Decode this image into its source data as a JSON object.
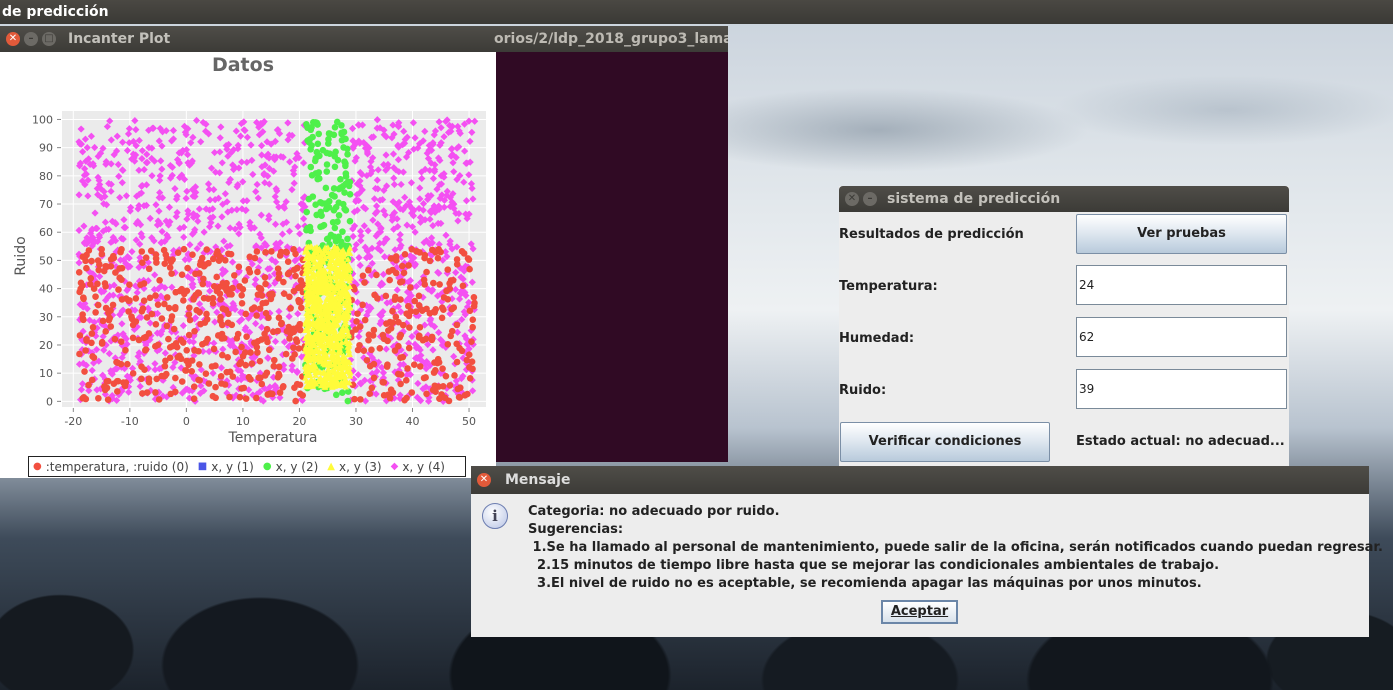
{
  "desktop": {
    "top_title": "de predicción"
  },
  "plot_window": {
    "title": "Incanter Plot",
    "path_fragment": "orios/2/ldp_2018_grupo3_lama"
  },
  "chart_data": {
    "type": "scatter",
    "title": "Datos",
    "xlabel": "Temperatura",
    "ylabel": "Ruido",
    "xlim": [
      -22,
      53
    ],
    "ylim": [
      -2,
      103
    ],
    "x_ticks": [
      "-20",
      "-10",
      "0",
      "10",
      "20",
      "30",
      "40",
      "50"
    ],
    "y_ticks": [
      "0",
      "10",
      "20",
      "30",
      "40",
      "50",
      "60",
      "70",
      "80",
      "90",
      "100"
    ],
    "grid": true,
    "legend_position": "bottom",
    "series": [
      {
        "name": ":temperatura, :ruido (0)",
        "color": "#f24f3f",
        "marker": "circle",
        "region": {
          "x": [
            -19,
            51
          ],
          "y": [
            0,
            54
          ]
        }
      },
      {
        "name": "x, y (1)",
        "color": "#4a55e6",
        "marker": "square",
        "region": null
      },
      {
        "name": "x, y (2)",
        "color": "#4ef04a",
        "marker": "circle",
        "region": {
          "x": [
            21,
            29
          ],
          "y": [
            0,
            100
          ]
        }
      },
      {
        "name": "x, y (3)",
        "color": "#fffb3a",
        "marker": "triangle",
        "region": {
          "x": [
            21,
            29
          ],
          "y": [
            5,
            55
          ]
        }
      },
      {
        "name": "x, y (4)",
        "color": "#f450f2",
        "marker": "diamond",
        "region": {
          "x": [
            -19,
            51
          ],
          "y": [
            0,
            100
          ]
        }
      }
    ]
  },
  "prediction_window": {
    "title": "sistema de predicción",
    "results_label": "Resultados de predicción",
    "ver_pruebas": "Ver pruebas",
    "temp_label": "Temperatura:",
    "temp_value": "24",
    "hum_label": "Humedad:",
    "hum_value": "62",
    "ruido_label": "Ruido:",
    "ruido_value": "39",
    "verify_button": "Verificar condiciones",
    "status": "Estado actual: no adecuad..."
  },
  "message_dialog": {
    "title": "Mensaje",
    "lines": [
      "Categoria: no adecuado por ruido.",
      "Sugerencias:",
      " 1.Se ha llamado al personal de mantenimiento, puede salir de la oficina, serán notificados cuando puedan regresar.",
      "  2.15 minutos de tiempo libre hasta que se mejorar las condicionales ambientales de trabajo.",
      "  3.El nivel de ruido no es aceptable, se recomienda apagar las máquinas por unos minutos."
    ],
    "ok_button": "Aceptar"
  }
}
